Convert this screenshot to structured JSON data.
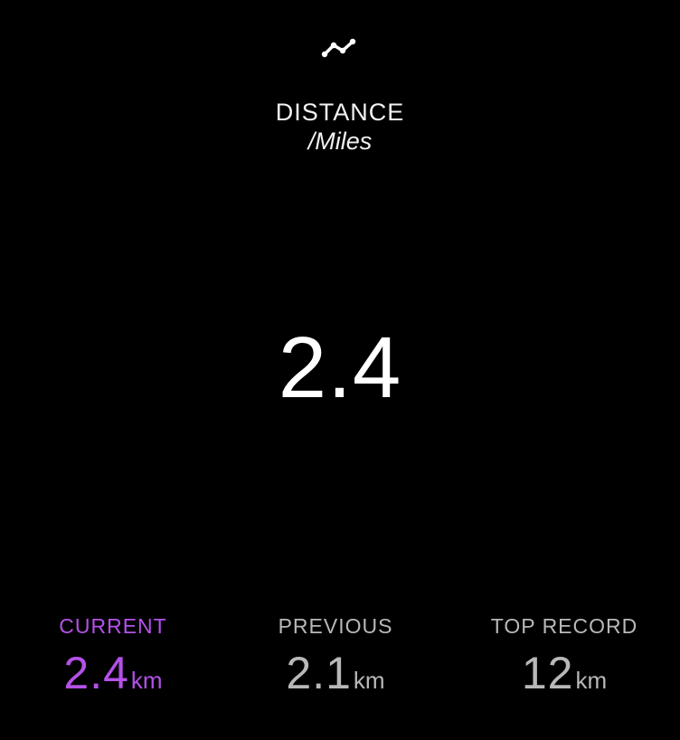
{
  "icon": "trend-line-icon",
  "header": {
    "title": "DISTANCE",
    "unit": "/Miles"
  },
  "main": {
    "value": "2.4"
  },
  "stats": {
    "current": {
      "label": "CURRENT",
      "value": "2.4",
      "unit": "km"
    },
    "previous": {
      "label": "PREVIOUS",
      "value": "2.1",
      "unit": "km"
    },
    "top_record": {
      "label": "TOP RECORD",
      "value": "12",
      "unit": "km"
    }
  },
  "colors": {
    "background": "#000000",
    "accent": "#b451e8",
    "secondary": "#b8b8b8",
    "primary_text": "#ffffff"
  }
}
